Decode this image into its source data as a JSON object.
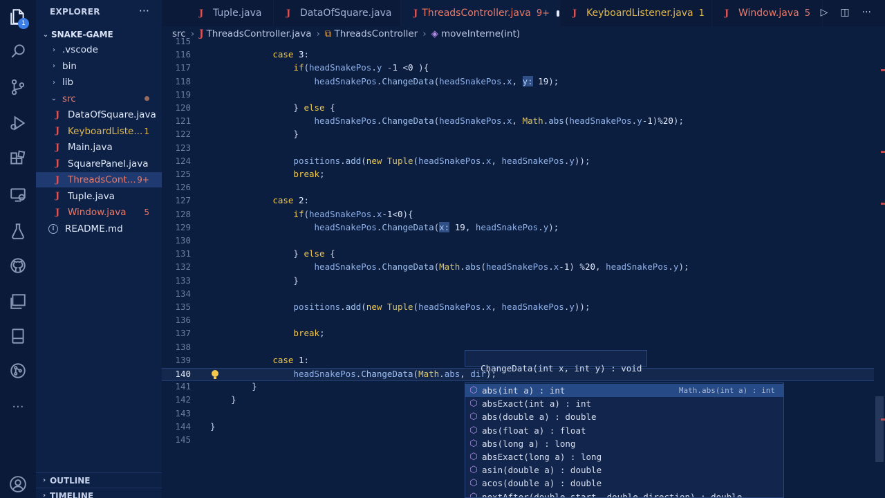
{
  "activity_bar": {
    "icons": [
      "explorer-icon",
      "search-icon",
      "source-control-icon",
      "run-debug-icon",
      "extensions-icon",
      "remote-explorer-icon",
      "testing-icon",
      "github-icon",
      "remote-window-icon",
      "notebook-icon",
      "timeline-icon",
      "more-icon",
      "account-icon"
    ],
    "explorer_badge": "1"
  },
  "sidebar": {
    "header": "EXPLORER",
    "more": "···",
    "project": "SNAKE-GAME",
    "items": [
      {
        "label": ".vscode",
        "type": "folder",
        "indent": 1,
        "expanded": false
      },
      {
        "label": "bin",
        "type": "folder",
        "indent": 1,
        "expanded": false
      },
      {
        "label": "lib",
        "type": "folder",
        "indent": 1,
        "expanded": false
      },
      {
        "label": "src",
        "type": "folder",
        "indent": 1,
        "expanded": true,
        "color": "#e87a6a",
        "modified_dot": true
      },
      {
        "label": "DataOfSquare.java",
        "type": "java",
        "indent": 2,
        "color": "#e0e8f6"
      },
      {
        "label": "KeyboardListe...",
        "type": "java",
        "indent": 2,
        "color": "#e0b84c",
        "badge": "1"
      },
      {
        "label": "Main.java",
        "type": "java",
        "indent": 2,
        "color": "#e0e8f6"
      },
      {
        "label": "SquarePanel.java",
        "type": "java",
        "indent": 2,
        "color": "#e0e8f6"
      },
      {
        "label": "ThreadsCont...",
        "type": "java",
        "indent": 2,
        "color": "#e87a6a",
        "badge": "9+",
        "selected": true
      },
      {
        "label": "Tuple.java",
        "type": "java",
        "indent": 2,
        "color": "#e0e8f6"
      },
      {
        "label": "Window.java",
        "type": "java",
        "indent": 2,
        "color": "#e87a6a",
        "badge": "5"
      },
      {
        "label": "README.md",
        "type": "md",
        "indent": 1,
        "color": "#e0e8f6"
      }
    ],
    "outline": "OUTLINE",
    "timeline": "TIMELINE"
  },
  "tabs": [
    {
      "label": "Tuple.java",
      "color": "#9fb0d3"
    },
    {
      "label": "DataOfSquare.java",
      "color": "#9fb0d3"
    },
    {
      "label": "ThreadsController.java",
      "badge": "9+",
      "active": true,
      "dirty": true,
      "color": "#e87a6a"
    },
    {
      "label": "KeyboardListener.java",
      "badge": "1",
      "color": "#e0b84c"
    },
    {
      "label": "Window.java",
      "badge": "5",
      "color": "#e87a6a"
    }
  ],
  "breadcrumb": {
    "parts": [
      "src",
      "ThreadsController.java",
      "ThreadsController",
      "moveInterne(int)"
    ]
  },
  "editor": {
    "current_line": "140",
    "lines": [
      {
        "n": "115",
        "code": ""
      },
      {
        "n": "116",
        "code": "            case 3:"
      },
      {
        "n": "117",
        "code": "                if(headSnakePos.y -1 <0 ){"
      },
      {
        "n": "118",
        "code": "                    headSnakePos.ChangeData(headSnakePos.x, y: 19);"
      },
      {
        "n": "119",
        "code": ""
      },
      {
        "n": "120",
        "code": "                } else {"
      },
      {
        "n": "121",
        "code": "                    headSnakePos.ChangeData(headSnakePos.x, Math.abs(headSnakePos.y-1)%20);"
      },
      {
        "n": "122",
        "code": "                }"
      },
      {
        "n": "123",
        "code": ""
      },
      {
        "n": "124",
        "code": "                positions.add(new Tuple(headSnakePos.x, headSnakePos.y));"
      },
      {
        "n": "125",
        "code": "                break;"
      },
      {
        "n": "126",
        "code": ""
      },
      {
        "n": "127",
        "code": "            case 2:"
      },
      {
        "n": "128",
        "code": "                if(headSnakePos.x-1<0){"
      },
      {
        "n": "129",
        "code": "                    headSnakePos.ChangeData(x: 19, headSnakePos.y);"
      },
      {
        "n": "130",
        "code": ""
      },
      {
        "n": "131",
        "code": "                } else {"
      },
      {
        "n": "132",
        "code": "                    headSnakePos.ChangeData(Math.abs(headSnakePos.x-1) %20, headSnakePos.y);"
      },
      {
        "n": "133",
        "code": "                }"
      },
      {
        "n": "134",
        "code": ""
      },
      {
        "n": "135",
        "code": "                positions.add(new Tuple(headSnakePos.x, headSnakePos.y));"
      },
      {
        "n": "136",
        "code": ""
      },
      {
        "n": "137",
        "code": "                break;"
      },
      {
        "n": "138",
        "code": ""
      },
      {
        "n": "139",
        "code": "            case 1:"
      },
      {
        "n": "140",
        "code": "                headSnakePos.ChangeData(Math.abs, dir);"
      },
      {
        "n": "141",
        "code": "        }"
      },
      {
        "n": "142",
        "code": "    }"
      },
      {
        "n": "143",
        "code": ""
      },
      {
        "n": "144",
        "code": "}"
      },
      {
        "n": "145",
        "code": ""
      }
    ]
  },
  "parameter_hint": "ChangeData(int x, int y) : void",
  "suggestions": {
    "items": [
      {
        "label": "abs(int a) : int",
        "detail": "Math.abs(int a) : int",
        "selected": true
      },
      {
        "label": "absExact(int a) : int"
      },
      {
        "label": "abs(double a) : double"
      },
      {
        "label": "abs(float a) : float"
      },
      {
        "label": "abs(long a) : long"
      },
      {
        "label": "absExact(long a) : long"
      },
      {
        "label": "asin(double a) : double"
      },
      {
        "label": "acos(double a) : double"
      },
      {
        "label": "nextAfter(double start, double direction) : double"
      }
    ]
  },
  "colors": {
    "accent": "#3b7fe8",
    "error": "#e87a6a",
    "warning": "#e0b84c",
    "keyword": "#f2c94c"
  }
}
